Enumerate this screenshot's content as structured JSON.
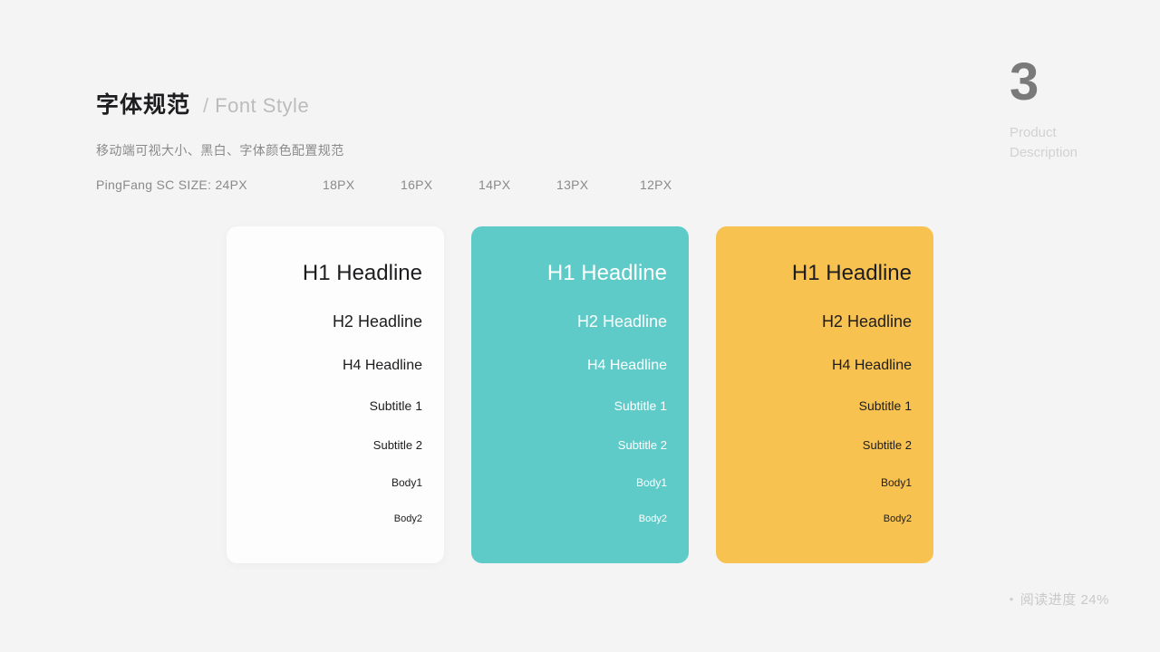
{
  "header": {
    "title_cn": "字体规范",
    "separator": "/",
    "title_en": "Font Style",
    "subtitle": "移动端可视大小、黑白、字体颜色配置规范",
    "size_lead": "PingFang SC SIZE: 24PX",
    "sizes": [
      "18PX",
      "16PX",
      "14PX",
      "13PX",
      "12PX"
    ]
  },
  "section": {
    "number": "3",
    "caption_line1": "Product",
    "caption_line2": "Description"
  },
  "cards": [
    {
      "name": "white-card",
      "background": "#fdfdfd",
      "text_color": "#1d1d1f",
      "rows": [
        "H1  Headline",
        "H2  Headline",
        "H4  Headline",
        "Subtitle 1",
        "Subtitle 2",
        "Body1",
        "Body2"
      ]
    },
    {
      "name": "teal-card",
      "background": "#5fcbc8",
      "text_color": "#ffffff",
      "rows": [
        "H1  Headline",
        "H2  Headline",
        "H4  Headline",
        "Subtitle 1",
        "Subtitle 2",
        "Body1",
        "Body2"
      ]
    },
    {
      "name": "yellow-card",
      "background": "#f7c24f",
      "text_color": "#1d1d1f",
      "rows": [
        "H1  Headline",
        "H2  Headline",
        "H4  Headline",
        "Subtitle 1",
        "Subtitle 2",
        "Body1",
        "Body2"
      ]
    }
  ],
  "progress": {
    "bullet": "•",
    "label": "阅读进度 24%"
  },
  "colors": {
    "background": "#f4f4f4",
    "teal": "#5fcbc8",
    "yellow": "#f7c24f",
    "white_card": "#fdfdfd",
    "title": "#1d1d1f",
    "muted": "#8a8a8a",
    "faint": "#d2d2d2"
  }
}
